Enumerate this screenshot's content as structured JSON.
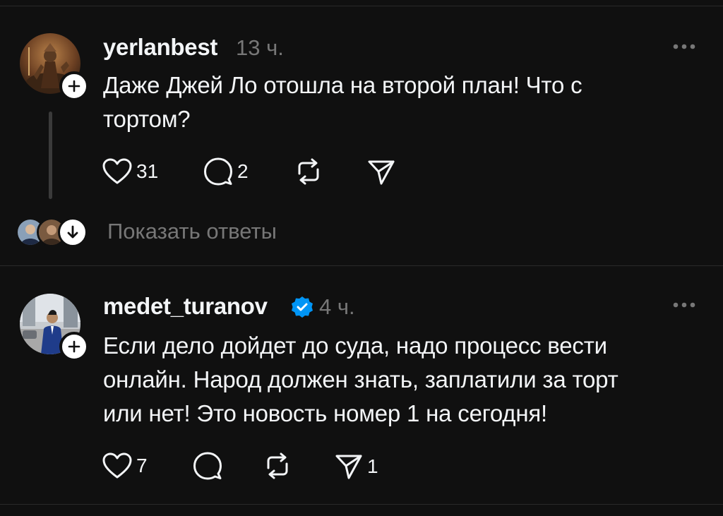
{
  "posts": [
    {
      "username": "yerlanbest",
      "time": "13 ч.",
      "verified": false,
      "text_lines": [
        "Даже Джей Ло отошла на второй план! Что с",
        "тортом?"
      ],
      "likes": "31",
      "comments": "2",
      "reposts": "",
      "shares": ""
    },
    {
      "username": "medet_turanov",
      "time": "4 ч.",
      "verified": true,
      "text_lines": [
        "Если дело дойдет до суда, надо процесс вести",
        "онлайн. Народ должен знать, заплатили за торт",
        "или нет! Это новость номер 1 на сегодня!"
      ],
      "likes": "7",
      "comments": "",
      "reposts": "",
      "shares": "1"
    }
  ],
  "show_replies_label": "Показать ответы",
  "colors": {
    "background": "#101010",
    "text": "#f3f5f7",
    "muted": "#777777",
    "verified": "#0095f6",
    "divider": "#2a2a2a"
  },
  "icons": {
    "like": "heart-icon",
    "comment": "speech-bubble-icon",
    "repost": "repost-icon",
    "share": "send-icon",
    "more": "more-horizontal-icon",
    "follow": "plus-icon",
    "expand": "arrow-down-icon",
    "verified": "verified-badge-icon"
  }
}
